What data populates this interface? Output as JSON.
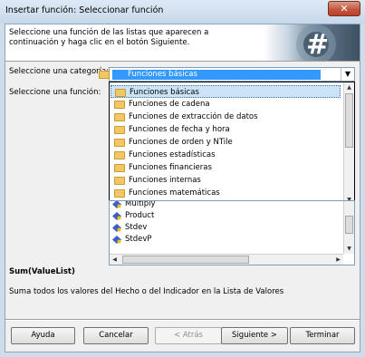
{
  "window": {
    "title": "Insertar función: Seleccionar función",
    "close_glyph": "✕"
  },
  "banner": {
    "instruction": "Seleccione una función de las listas que aparecen a continuación y haga clic en el botón Siguiente."
  },
  "category": {
    "label": "Seleccione una categoría:",
    "selected": "Funciones básicas",
    "options": [
      "Funciones básicas",
      "Funciones de cadena",
      "Funciones de extracción de datos",
      "Funciones de fecha y hora",
      "Funciones de orden y NTile",
      "Funciones estadísticas",
      "Funciones financieras",
      "Funciones internas",
      "Funciones matemáticas"
    ]
  },
  "function": {
    "label": "Seleccione una función:",
    "items": [
      "Multiply",
      "Product",
      "Stdev",
      "StdevP"
    ]
  },
  "signature": "Sum(ValueList)",
  "description": "Suma todos los valores del Hecho o del Indicador en la Lista de Valores",
  "buttons": {
    "help": "Ayuda",
    "cancel": "Cancelar",
    "back": "< Atrás",
    "next": "Siguiente >",
    "finish": "Terminar"
  }
}
